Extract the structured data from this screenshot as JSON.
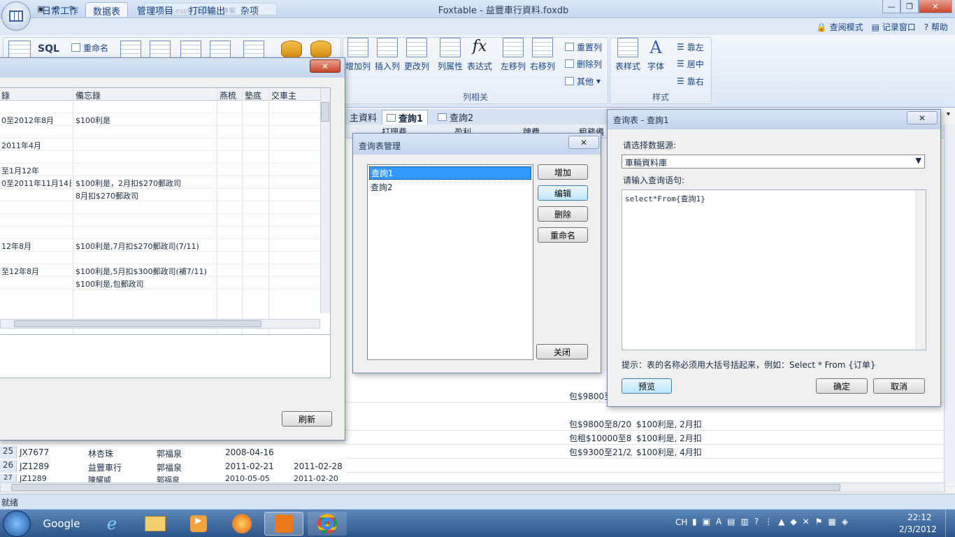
{
  "titlebar": {
    "title": "Foxtable - 益豐車行資料.foxdb",
    "faded_tab": "遊行Access作品查詢 - 專案",
    "min": "—",
    "max": "❐",
    "close": "✕"
  },
  "menu": {
    "tabs": [
      "日常工作",
      "数据表",
      "管理项目",
      "打印输出",
      "杂项"
    ],
    "right_links": [
      "查阅模式",
      "记录窗口",
      "帮助"
    ]
  },
  "ribbon": {
    "sql_label": "SQL",
    "rename_label": "重命名",
    "col_buttons": [
      "增加列",
      "插入列",
      "更改列",
      "列属性",
      "表达式",
      "左移列",
      "右移列"
    ],
    "col_side": [
      "重置列",
      "删除列",
      "其他"
    ],
    "col_group_label": "列相关",
    "style_buttons": [
      "表样式",
      "字体"
    ],
    "align": [
      "靠左",
      "居中",
      "靠右"
    ],
    "style_group_label": "样式",
    "fx": "fx"
  },
  "doc_tabs": [
    "主資料",
    "查詢1",
    "查詢2"
  ],
  "grid": {
    "headers": [
      "打理费",
      "盈利",
      "牌費",
      "租務備"
    ],
    "rows": [
      {
        "num": "",
        "c1": "",
        "c2": "",
        "c3": "",
        "c4": "",
        "c5": "",
        "c6": "包$9800至",
        "c7": ""
      },
      {
        "num": "",
        "c1": "",
        "c2": "",
        "c3": "",
        "c4": "",
        "c5": "",
        "c6": "包$9800至8/201",
        "c7": "$100利是, 2月扣"
      },
      {
        "num": "",
        "c1": "",
        "c2": "",
        "c3": "",
        "c4": "",
        "c5": "",
        "c6": "包租$10000至8",
        "c7": "$100利是, 2月扣"
      },
      {
        "num": "25",
        "c1": "JX7677",
        "c2": "林杏珠",
        "c3": "郭福泉",
        "c4": "2008-04-16",
        "c5": "",
        "c6": "包$9300至21/2/",
        "c7": "$100利是, 4月扣"
      },
      {
        "num": "26",
        "c1": "JZ1289",
        "c2": "益豐車行",
        "c3": "郭福泉",
        "c4": "2011-02-21",
        "c5": "2011-02-28",
        "c6": "",
        "c7": ""
      },
      {
        "num": "27",
        "c1": "JZ1289",
        "c2": "陳耀威",
        "c3": "郭福泉",
        "c4": "2010-05-05",
        "c5": "2011-02-20",
        "c6": "",
        "c7": ""
      }
    ]
  },
  "left_window": {
    "columns": [
      "錄",
      "備忘錄",
      "燕梳",
      "墊底",
      "交車主"
    ],
    "rows": [
      {
        "a": "",
        "b": ""
      },
      {
        "a": "0至2012年8月",
        "b": "$100利是"
      },
      {
        "a": "",
        "b": ""
      },
      {
        "a": "2011年4月",
        "b": ""
      },
      {
        "a": "",
        "b": ""
      },
      {
        "a": "至1月12年",
        "b": ""
      },
      {
        "a": "0至2011年11月14日",
        "b": "$100利是，2月扣$270郵政司"
      },
      {
        "a": "",
        "b": "8月扣$270郵政司"
      },
      {
        "a": "",
        "b": ""
      },
      {
        "a": "",
        "b": ""
      },
      {
        "a": "",
        "b": ""
      },
      {
        "a": "12年8月",
        "b": "$100利是,7月扣$270郵政司(7/11)"
      },
      {
        "a": "",
        "b": ""
      },
      {
        "a": "至12年8月",
        "b": "$100利是,5月扣$300郵政司(補7/11)"
      },
      {
        "a": "",
        "b": "$100利是,包郵政司"
      }
    ],
    "refresh": "刷新",
    "close": "✕"
  },
  "query_mgr": {
    "title": "查询表管理",
    "items": [
      "查詢1",
      "查詢2"
    ],
    "buttons": [
      "增加",
      "编辑",
      "删除",
      "重命名"
    ],
    "close_btn": "关闭",
    "x": "✕"
  },
  "query_edit": {
    "title": "查询表 - 查詢1",
    "source_label": "请选择数据源:",
    "source_value": "車輛資料庫",
    "sql_label": "请输入查询语句:",
    "sql_text": "select*From{查詢1}",
    "hint": "提示：表的名称必须用大括号括起来，例如：Select * From {订单}",
    "preview": "预览",
    "ok": "确定",
    "cancel": "取消",
    "x": "✕"
  },
  "status": {
    "text": "就绪"
  },
  "taskbar": {
    "google": "Google",
    "lang": "CH",
    "time": "22:12",
    "date": "2/3/2012"
  }
}
